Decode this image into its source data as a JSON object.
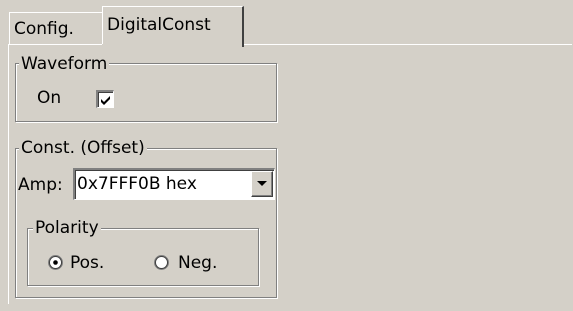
{
  "tabs": [
    {
      "label": "Config.",
      "active": false
    },
    {
      "label": "DigitalConst",
      "active": true
    }
  ],
  "waveform": {
    "title": "Waveform",
    "on_label": "On",
    "on_checked": true
  },
  "offset": {
    "title": "Const. (Offset)",
    "amp_label": "Amp:",
    "amp_value": "0x7FFF0B hex"
  },
  "polarity": {
    "title": "Polarity",
    "options": [
      {
        "label": "Pos.",
        "selected": true
      },
      {
        "label": "Neg.",
        "selected": false
      }
    ]
  },
  "icons": {
    "checkmark": "check-icon",
    "dropdown": "chevron-down-icon"
  },
  "colors": {
    "face": "#d4d0c8",
    "shadow": "#808080",
    "highlight": "#ffffff",
    "dark_shadow": "#404040"
  }
}
